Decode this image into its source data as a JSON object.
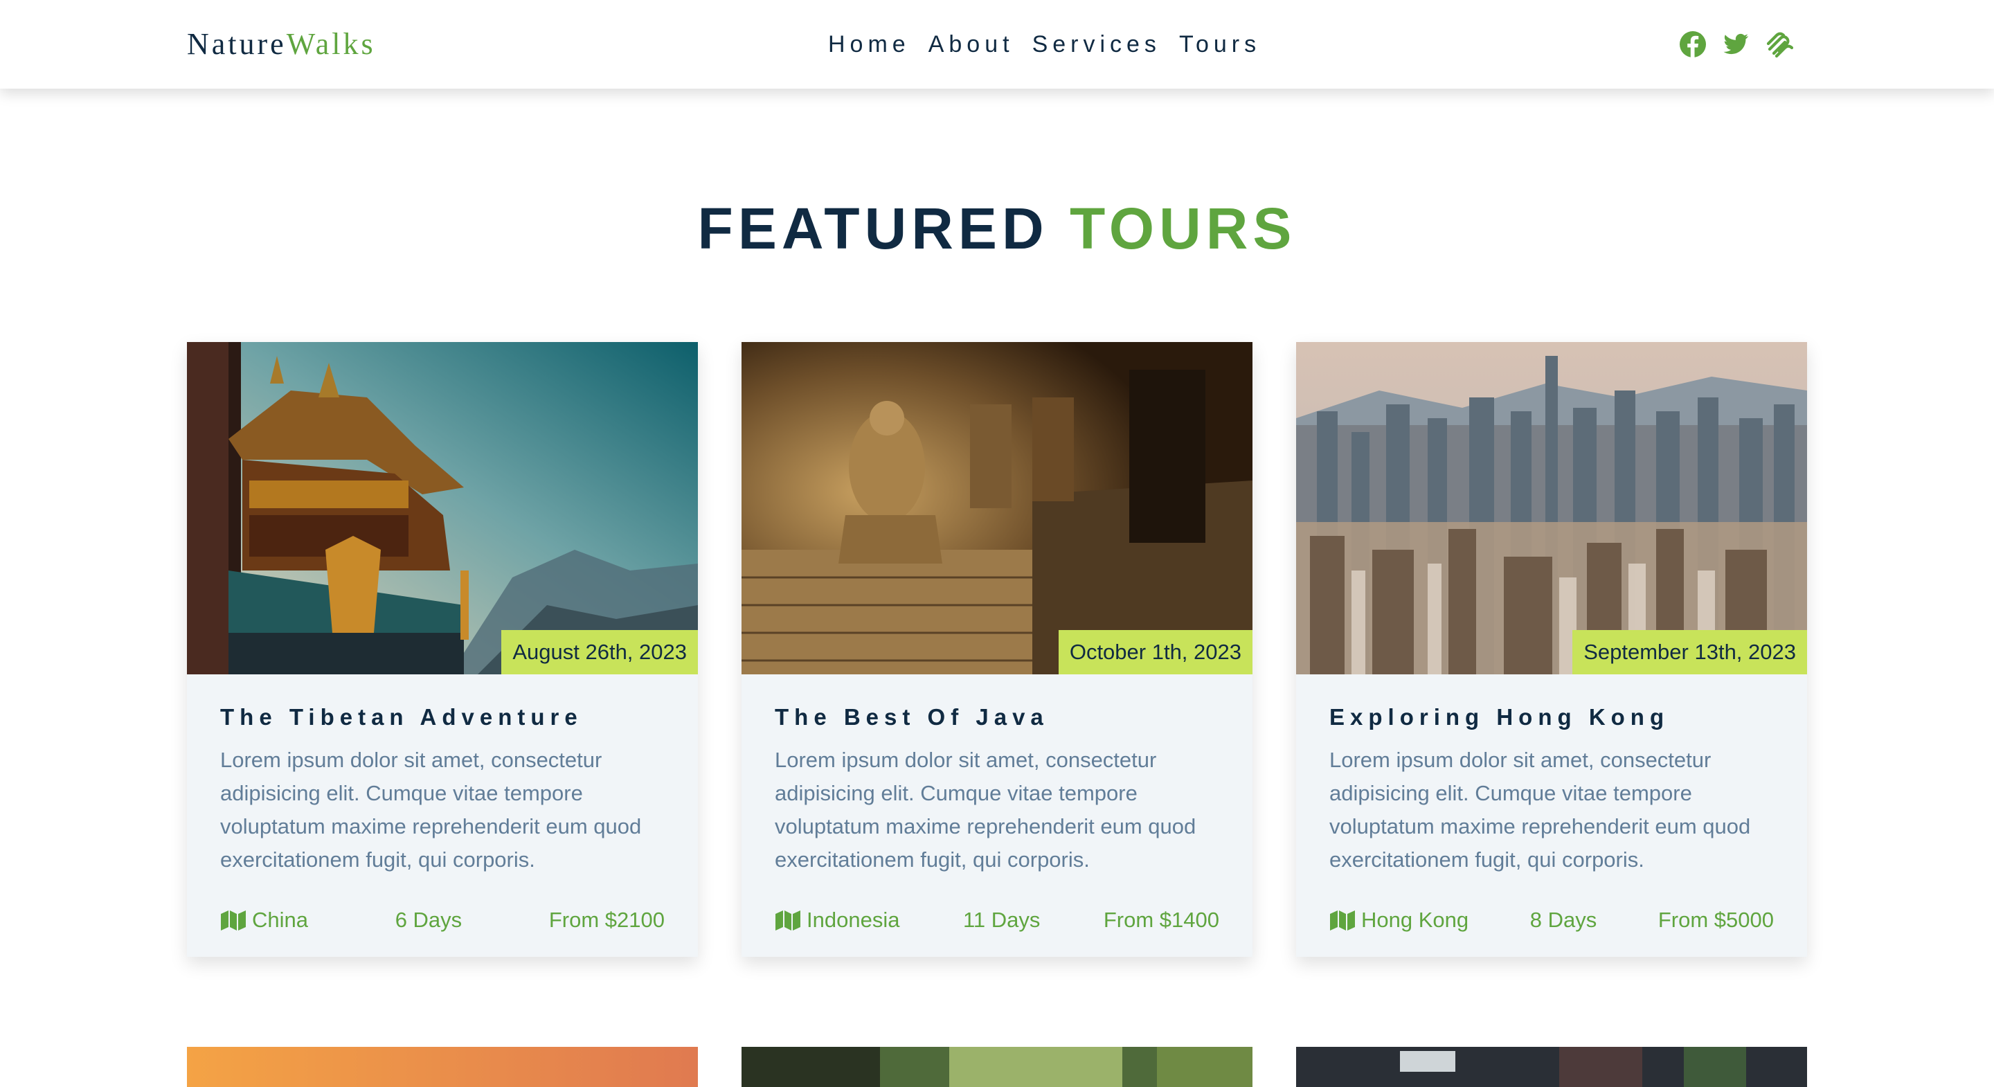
{
  "nav": {
    "logo_part1": "Nature",
    "logo_part2": "Walks",
    "links": [
      "Home",
      "About",
      "Services",
      "Tours"
    ],
    "icons": [
      "facebook-icon",
      "twitter-icon",
      "squarespace-icon"
    ]
  },
  "section": {
    "title_part1": "FEATURED",
    "title_part2": "TOURS"
  },
  "tours": [
    {
      "date": "August 26th, 2023",
      "title": "The Tibetan Adventure",
      "text": "Lorem ipsum dolor sit amet, consectetur adipisicing elit. Cumque vitae tempore voluptatum maxime reprehenderit eum quod exercitationem fugit, qui corporis.",
      "location": "China",
      "duration": "6 Days",
      "price": "From $2100"
    },
    {
      "date": "October 1th, 2023",
      "title": "The Best Of Java",
      "text": "Lorem ipsum dolor sit amet, consectetur adipisicing elit. Cumque vitae tempore voluptatum maxime reprehenderit eum quod exercitationem fugit, qui corporis.",
      "location": "Indonesia",
      "duration": "11 Days",
      "price": "From $1400"
    },
    {
      "date": "September 13th, 2023",
      "title": "Exploring Hong Kong",
      "text": "Lorem ipsum dolor sit amet, consectetur adipisicing elit. Cumque vitae tempore voluptatum maxime reprehenderit eum quod exercitationem fugit, qui corporis.",
      "location": "Hong Kong",
      "duration": "8 Days",
      "price": "From $5000"
    }
  ],
  "colors": {
    "primary": "#102a42",
    "accent": "#5fa53f",
    "badge": "#c8e35a",
    "card_bg": "#f1f5f8",
    "body_text": "#617d98"
  }
}
